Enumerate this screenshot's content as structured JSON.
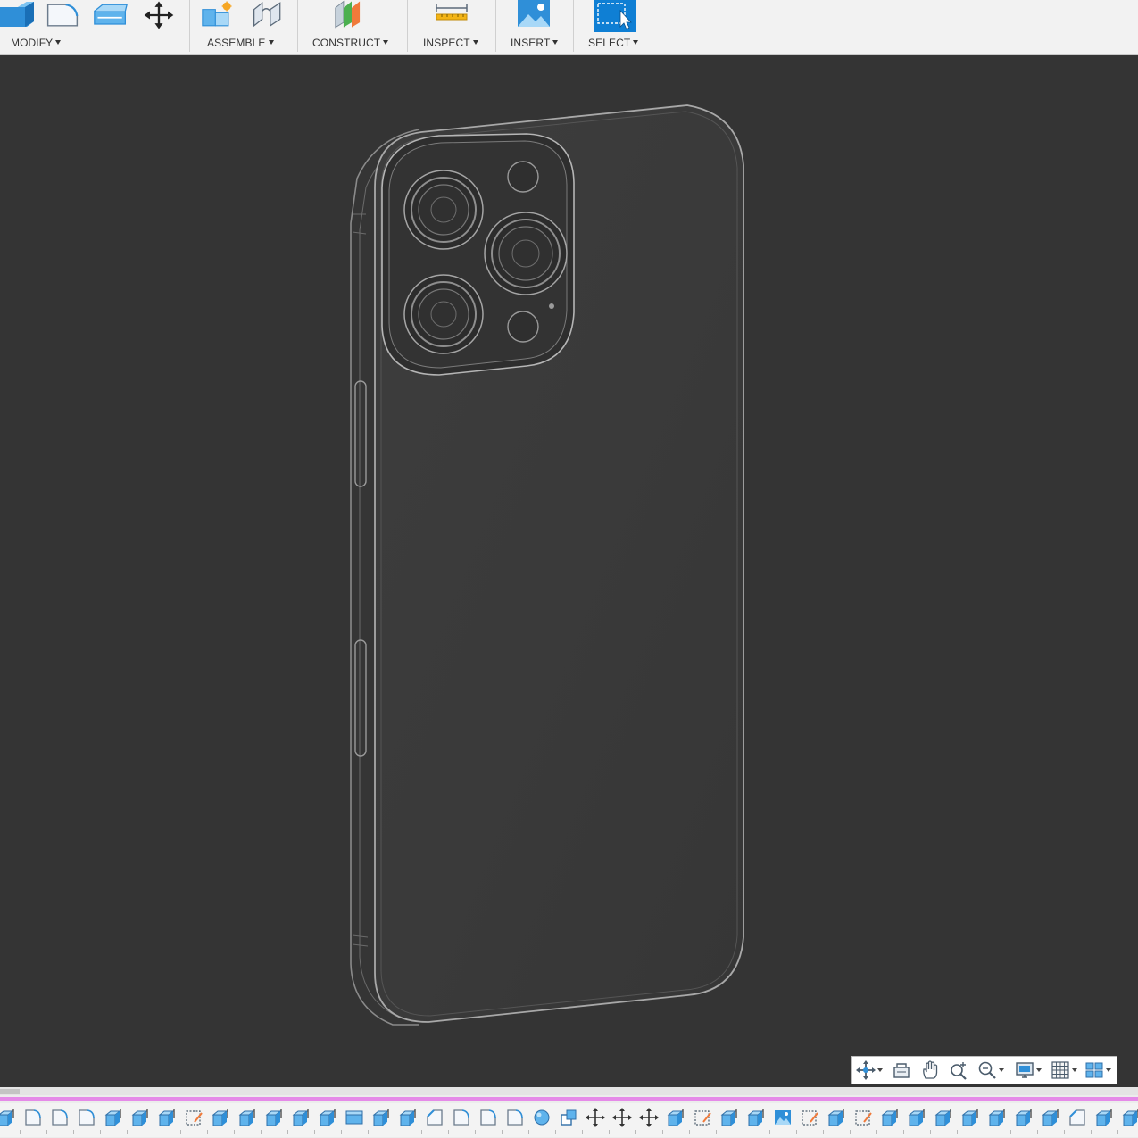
{
  "toolbar": {
    "groups": [
      {
        "id": "modify",
        "label": "MODIFY"
      },
      {
        "id": "assemble",
        "label": "ASSEMBLE"
      },
      {
        "id": "construct",
        "label": "CONSTRUCT"
      },
      {
        "id": "inspect",
        "label": "INSPECT"
      },
      {
        "id": "insert",
        "label": "INSERT"
      },
      {
        "id": "select",
        "label": "SELECT"
      }
    ],
    "icons": {
      "modify": [
        "press-pull-icon",
        "fillet-icon",
        "shell-icon",
        "move-icon"
      ],
      "assemble": [
        "new-component-icon",
        "joint-icon"
      ],
      "construct": [
        "offset-plane-icon"
      ],
      "inspect": [
        "measure-icon"
      ],
      "insert": [
        "insert-image-icon"
      ],
      "select": [
        "select-icon"
      ]
    },
    "accent": "#1a9be0"
  },
  "viewport": {
    "background": "#343434",
    "model": "phone-body-wireframe"
  },
  "navigation_bar": {
    "items": [
      "orbit-icon",
      "look-at-icon",
      "pan-icon",
      "zoom-window-icon",
      "fit-zoom-icon",
      "display-settings-icon",
      "grid-settings-icon",
      "viewports-icon"
    ]
  },
  "timeline": {
    "marker_color": "#e58ae8",
    "features": [
      "extrude",
      "fillet",
      "fillet",
      "fillet",
      "extrude",
      "extrude",
      "extrude",
      "sketch",
      "extrude",
      "extrude",
      "extrude",
      "extrude",
      "extrude",
      "shell",
      "extrude",
      "extrude",
      "chamfer",
      "fillet",
      "fillet",
      "fillet",
      "sphere",
      "box",
      "move",
      "move",
      "move",
      "extrude",
      "sketch",
      "extrude",
      "extrude",
      "image",
      "sketch",
      "extrude",
      "sketch",
      "extrude",
      "extrude",
      "extrude",
      "extrude",
      "extrude",
      "extrude",
      "extrude",
      "chamfer",
      "extrude",
      "extrude"
    ]
  }
}
